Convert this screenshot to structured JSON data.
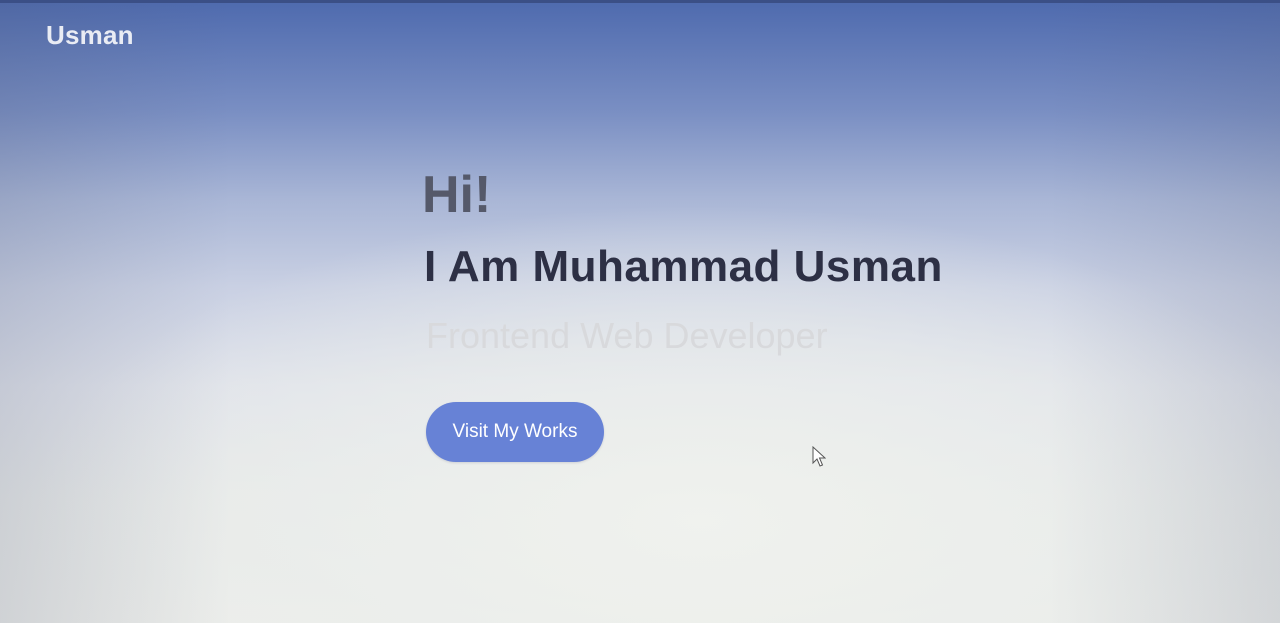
{
  "header": {
    "brand": "Usman"
  },
  "hero": {
    "greeting": "Hi!",
    "name_line": "I Am Muhammad Usman",
    "role": "Frontend Web Developer",
    "cta_label": "Visit My Works"
  },
  "colors": {
    "cta_background": "#6782d6",
    "name_text": "#2d3045",
    "greeting_text": "#55596a",
    "role_text": "#d8d9dc"
  },
  "icons": {
    "pointer": "mouse-cursor-icon"
  }
}
